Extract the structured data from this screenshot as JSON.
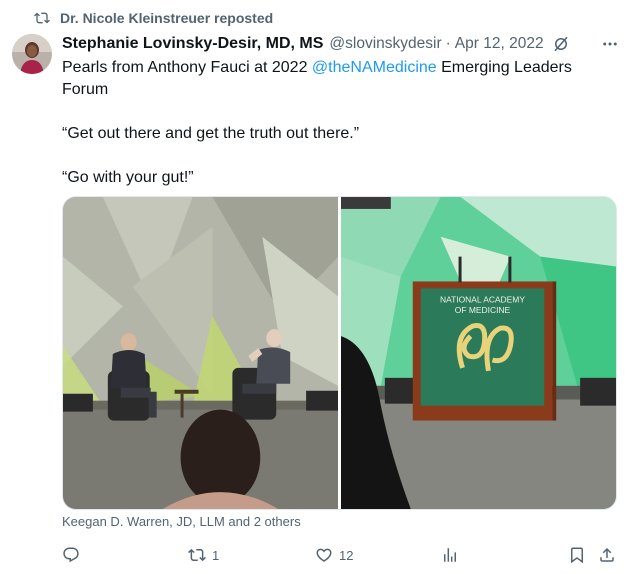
{
  "repost": {
    "label": "Dr. Nicole Kleinstreuer reposted",
    "icon": "repost-icon"
  },
  "author": {
    "name": "Stephanie Lovinsky-Desir, MD, MS",
    "handle": "@slovinskydesir",
    "separator": "·",
    "date": "Apr 12, 2022"
  },
  "tweet": {
    "line1_prefix": "Pearls from Anthony Fauci at 2022 ",
    "mention": "@theNAMedicine",
    "line1_suffix": " Emerging Leaders",
    "line2": "Forum",
    "quote1": "“Get out there and get the truth out there.”",
    "quote2": "“Go with your gut!”"
  },
  "media": {
    "podium_line1": "NATIONAL ACADEMY",
    "podium_line2": "OF MEDICINE"
  },
  "likers": "Keegan D. Warren, JD, LLM and 2 others",
  "actions": {
    "reply_count": "",
    "repost_count": "1",
    "like_count": "12",
    "views_count": ""
  },
  "colors": {
    "accent": "#1d9bf0",
    "secondary_text": "#536471",
    "primary_text": "#0f1419"
  }
}
